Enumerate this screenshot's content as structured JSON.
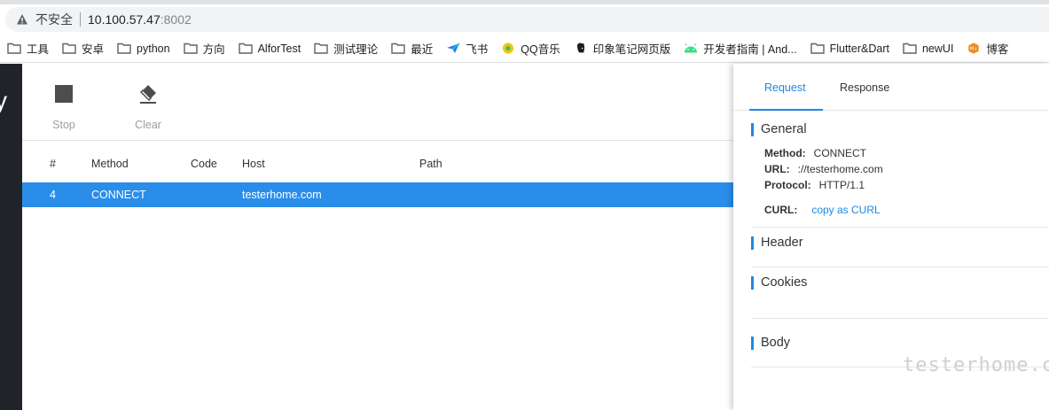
{
  "browser": {
    "security_label": "不安全",
    "host": "10.100.57.47",
    "port": ":8002",
    "bookmarks": [
      {
        "label": "工具",
        "icon": "folder-icon"
      },
      {
        "label": "安卓",
        "icon": "folder-icon"
      },
      {
        "label": "python",
        "icon": "folder-icon"
      },
      {
        "label": "方向",
        "icon": "folder-icon"
      },
      {
        "label": "AlforTest",
        "icon": "folder-icon"
      },
      {
        "label": "测试理论",
        "icon": "folder-icon"
      },
      {
        "label": "最近",
        "icon": "folder-icon"
      },
      {
        "label": "飞书",
        "icon": "feishu-icon"
      },
      {
        "label": "QQ音乐",
        "icon": "qqmusic-icon"
      },
      {
        "label": "印象笔记网页版",
        "icon": "evernote-icon"
      },
      {
        "label": "开发者指南 | And...",
        "icon": "android-icon"
      },
      {
        "label": "Flutter&Dart",
        "icon": "folder-icon"
      },
      {
        "label": "newUI",
        "icon": "folder-icon"
      },
      {
        "label": "博客",
        "icon": "blog-icon"
      }
    ]
  },
  "app": {
    "brand_fragment": "y",
    "toolbar": {
      "stop_label": "Stop",
      "clear_label": "Clear"
    },
    "table": {
      "headers": [
        "#",
        "Method",
        "Code",
        "Host",
        "Path"
      ],
      "rows": [
        {
          "num": "4",
          "method": "CONNECT",
          "code": "",
          "host": "testerhome.com",
          "path": ""
        }
      ]
    },
    "panel": {
      "tabs": [
        "Request",
        "Response"
      ],
      "active_tab": "Request",
      "general_title": "General",
      "method_key": "Method:",
      "method_val": "CONNECT",
      "url_key": "URL:",
      "url_val": "://testerhome.com",
      "protocol_key": "Protocol:",
      "protocol_val": "HTTP/1.1",
      "curl_key": "CURL:",
      "curl_link": "copy as CURL",
      "header_title": "Header",
      "cookies_title": "Cookies",
      "body_title": "Body"
    },
    "watermark": "testerhome.com",
    "colors": {
      "accent": "#1e88e5",
      "selected_row": "#2a8de9",
      "sidebar": "#202329"
    }
  }
}
